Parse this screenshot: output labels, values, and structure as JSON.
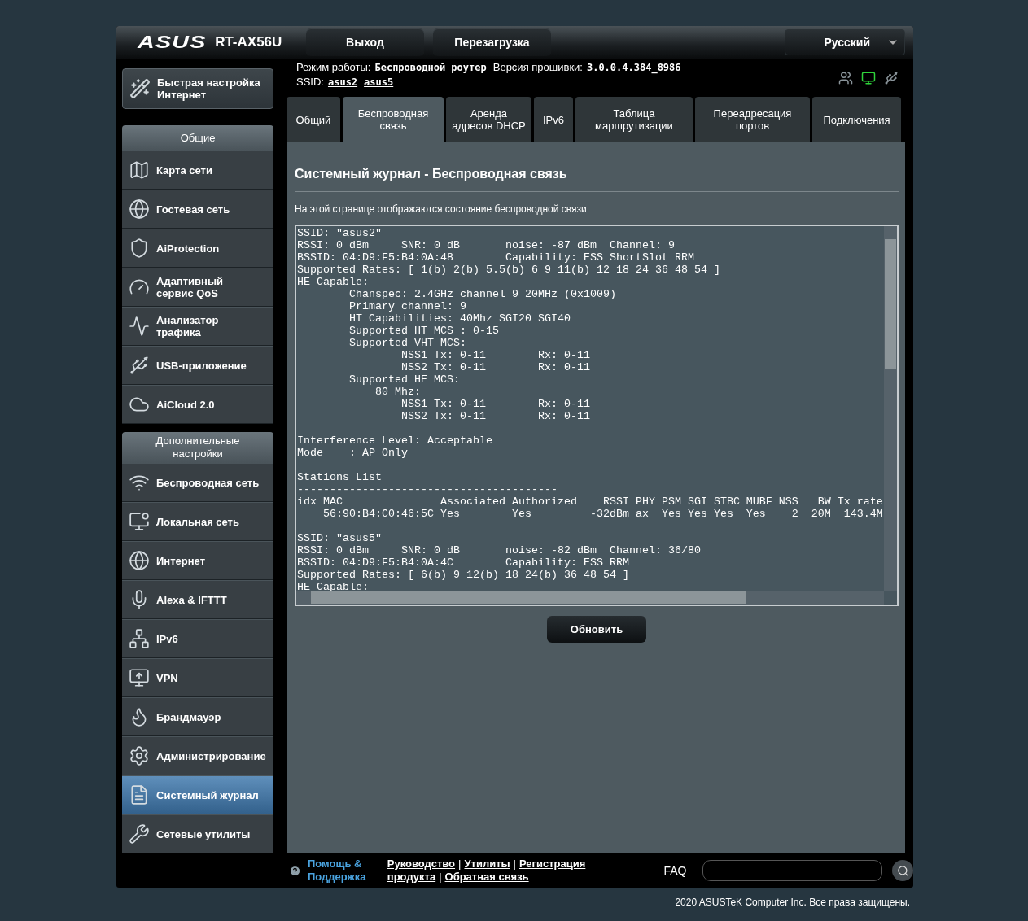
{
  "header": {
    "logo": "ASUS",
    "model": "RT-AX56U",
    "buttons": [
      "Выход",
      "Перезагрузка"
    ],
    "language": "Русский"
  },
  "status": {
    "mode_label": "Режим работы:",
    "mode": "Беспроводной роутер",
    "firmware_label": "Версия прошивки:",
    "firmware": "3.0.0.4.384_8986",
    "ssid_label": "SSID:",
    "ssids": [
      "asus2",
      "asus5"
    ]
  },
  "status_icons": [
    {
      "color": "#8a949a"
    },
    {
      "color": "#2fd33a"
    },
    {
      "color": "#8a949a"
    }
  ],
  "quick_setup": "Быстрая настройка Интернет",
  "sidebar": [
    {
      "heading": "Общие",
      "items": [
        {
          "label": "Карта сети",
          "selected": false
        },
        {
          "label": "Гостевая сеть",
          "selected": false
        },
        {
          "label": "AiProtection",
          "selected": false
        },
        {
          "label": "Адаптивный сервис QoS",
          "selected": false
        },
        {
          "label": "Анализатор трафика",
          "selected": false
        },
        {
          "label": "USB-приложение",
          "selected": false
        },
        {
          "label": "AiCloud 2.0",
          "selected": false
        }
      ]
    },
    {
      "heading": "Дополнительные настройки",
      "items": [
        {
          "label": "Беспроводная сеть",
          "selected": false
        },
        {
          "label": "Локальная сеть",
          "selected": false
        },
        {
          "label": "Интернет",
          "selected": false
        },
        {
          "label": "Alexa & IFTTT",
          "selected": false
        },
        {
          "label": "IPv6",
          "selected": false
        },
        {
          "label": "VPN",
          "selected": false
        },
        {
          "label": "Брандмауэр",
          "selected": false
        },
        {
          "label": "Администрирование",
          "selected": false
        },
        {
          "label": "Системный журнал",
          "selected": true
        },
        {
          "label": "Сетевые утилиты",
          "selected": false
        }
      ]
    }
  ],
  "tabs": [
    {
      "label": "Общий",
      "selected": false
    },
    {
      "label": "Беспроводная связь",
      "selected": true
    },
    {
      "label": "Аренда адресов DHCP",
      "selected": false
    },
    {
      "label": "IPv6",
      "selected": false
    },
    {
      "label": "Таблица маршрутизации",
      "selected": false
    },
    {
      "label": "Переадресация портов",
      "selected": false
    },
    {
      "label": "Подключения",
      "selected": false
    }
  ],
  "page": {
    "title": "Системный журнал - Беспроводная связь",
    "description": "На этой странице отображаются состояние беспроводной связи",
    "log": "SSID: \"asus2\"\nRSSI: 0 dBm     SNR: 0 dB       noise: -87 dBm  Channel: 9\nBSSID: 04:D9:F5:B4:0A:48        Capability: ESS ShortSlot RRM\nSupported Rates: [ 1(b) 2(b) 5.5(b) 6 9 11(b) 12 18 24 36 48 54 ]\nHE Capable:\n        Chanspec: 2.4GHz channel 9 20MHz (0x1009)\n        Primary channel: 9\n        HT Capabilities: 40Mhz SGI20 SGI40\n        Supported HT MCS : 0-15\n        Supported VHT MCS:\n                NSS1 Tx: 0-11        Rx: 0-11\n                NSS2 Tx: 0-11        Rx: 0-11\n        Supported HE MCS:\n            80 Mhz:\n                NSS1 Tx: 0-11        Rx: 0-11\n                NSS2 Tx: 0-11        Rx: 0-11\n\nInterference Level: Acceptable\nMode    : AP Only\n\nStations List\n----------------------------------------\nidx MAC               Associated Authorized    RSSI PHY PSM SGI STBC MUBF NSS   BW Tx rate\n    56:90:B4:C0:46:5C Yes        Yes         -32dBm ax  Yes Yes Yes  Yes    2  20M  143.4M\n\nSSID: \"asus5\"\nRSSI: 0 dBm     SNR: 0 dB       noise: -82 dBm  Channel: 36/80\nBSSID: 04:D9:F5:B4:0A:4C        Capability: ESS RRM\nSupported Rates: [ 6(b) 9 12(b) 18 24(b) 36 48 54 ]\nHE Capable:",
    "button": "Обновить"
  },
  "footer": {
    "help": "Помощь & Поддержка",
    "links": [
      "Руководство",
      "Утилиты",
      "Регистрация продукта",
      "Обратная связь"
    ],
    "separators": [
      "|",
      "|",
      "|"
    ],
    "faq": "FAQ"
  },
  "copyright": "2020 ASUSTeK Computer Inc. Все права защищены."
}
